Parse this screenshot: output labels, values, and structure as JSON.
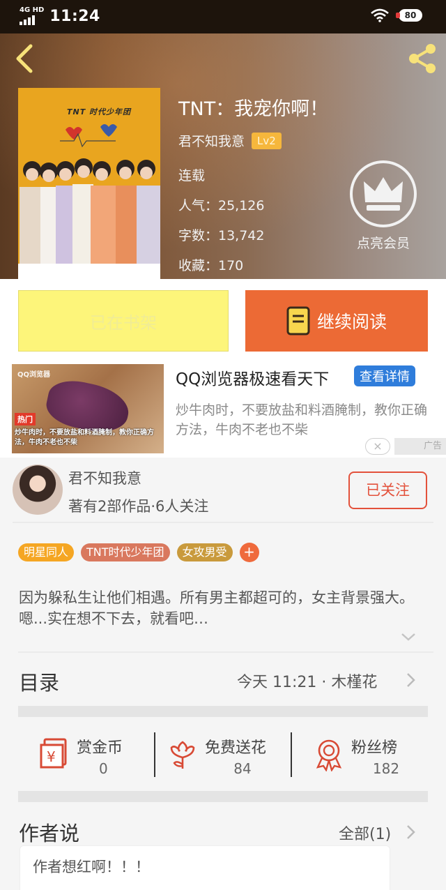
{
  "status_bar": {
    "network": "4G HD",
    "time": "11:24",
    "extra": "",
    "battery": "80"
  },
  "book": {
    "title": "TNT：我宠你啊！",
    "author": "君不知我意",
    "level": "Lv2",
    "status": "连载",
    "popularity": "人气：25,126",
    "word_count": "字数：13,742",
    "favorites": "收藏：170",
    "cover_text": "TNT 时代少年团"
  },
  "vip": {
    "label": "点亮会员"
  },
  "actions": {
    "shelf_label": "已在书架",
    "read_label": "继续阅读"
  },
  "ad": {
    "title": "QQ浏览器极速看天下",
    "button": "查看详情",
    "description": "炒牛肉时，不要放盐和料酒腌制，教你正确方法，牛肉不老也不柴",
    "image_logo": "QQ浏览器",
    "image_hot": "热门",
    "image_caption": "炒牛肉时，不要放盐和料酒腌制，教你正确方法，牛肉不老也不柴",
    "tag": "广告",
    "close": "×"
  },
  "author_card": {
    "name": "君不知我意",
    "stats": "著有2部作品·6人关注",
    "follow_label": "已关注"
  },
  "tags": [
    {
      "label": "明星同人",
      "color": "#f5a623"
    },
    {
      "label": "TNT时代少年团",
      "color": "#d9785e"
    },
    {
      "label": "女攻男受",
      "color": "#c99a3c"
    }
  ],
  "tag_add": "+",
  "synopsis": "因为躲私生让他们相遇。所有男主都超可的，女主背景强大。嗯...实在想不下去，就看吧…",
  "toc": {
    "label": "目录",
    "update": "今天 11:21 · 木槿花"
  },
  "stats": [
    {
      "label": "赏金币",
      "value": "0",
      "icon": "coin-envelope-icon"
    },
    {
      "label": "免费送花",
      "value": "84",
      "icon": "flower-icon"
    },
    {
      "label": "粉丝榜",
      "value": "182",
      "icon": "medal-icon"
    }
  ],
  "author_says": {
    "label": "作者说",
    "all": "全部(1)",
    "content": "作者想红啊！！！"
  },
  "colors": {
    "accent_orange": "#ec6a35",
    "shelf_yellow": "#fdf57a",
    "follow_red": "#e3513b",
    "ad_blue": "#2f7ddb"
  }
}
